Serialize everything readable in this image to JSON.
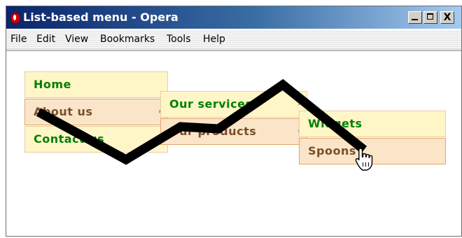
{
  "window": {
    "title": "List-based menu - Opera",
    "controls": {
      "minimize": "_",
      "maximize": "□",
      "close": "X"
    }
  },
  "menubar": {
    "items": [
      "File",
      "Edit",
      "View",
      "Bookmarks",
      "Tools",
      "Help"
    ]
  },
  "nav_menu": {
    "level1": [
      "Home",
      "About us",
      "Contact us"
    ],
    "level2": [
      "Our services",
      "Our products"
    ],
    "level3": [
      "Widgets",
      "Spoons"
    ],
    "submenu_arrow": "›"
  },
  "colors": {
    "menu_light_bg": "#fff6c8",
    "menu_peach_bg": "#fbe5c8",
    "menu_text_green": "#008000",
    "menu_text_brown": "#7a4e2b",
    "scribble": "#000000"
  },
  "icons": {
    "app": "opera-icon",
    "cursor": "hand-pointer-icon"
  }
}
